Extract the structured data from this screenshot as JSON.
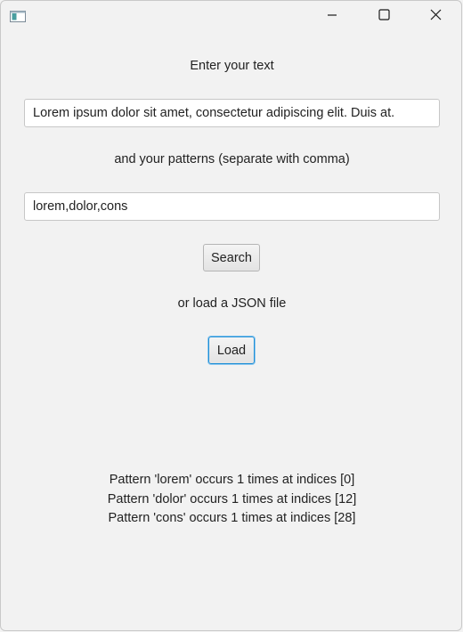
{
  "window": {
    "icons": {
      "app": "app-window-icon",
      "minimize": "minimize-icon",
      "maximize": "maximize-icon",
      "close": "close-icon"
    }
  },
  "form": {
    "text_label": "Enter your text",
    "text_value": "Lorem ipsum dolor sit amet, consectetur adipiscing elit. Duis at.",
    "patterns_label": "and your patterns (separate with comma)",
    "patterns_value": "lorem,dolor,cons",
    "search_button": "Search",
    "load_label": "or load a JSON file",
    "load_button": "Load"
  },
  "results": [
    "Pattern 'lorem' occurs 1 times at indices [0]",
    "Pattern 'dolor' occurs 1 times at indices [12]",
    "Pattern 'cons' occurs 1 times at indices [28]"
  ],
  "colors": {
    "background": "#f2f2f2",
    "focus_border": "#1f8fd6"
  }
}
